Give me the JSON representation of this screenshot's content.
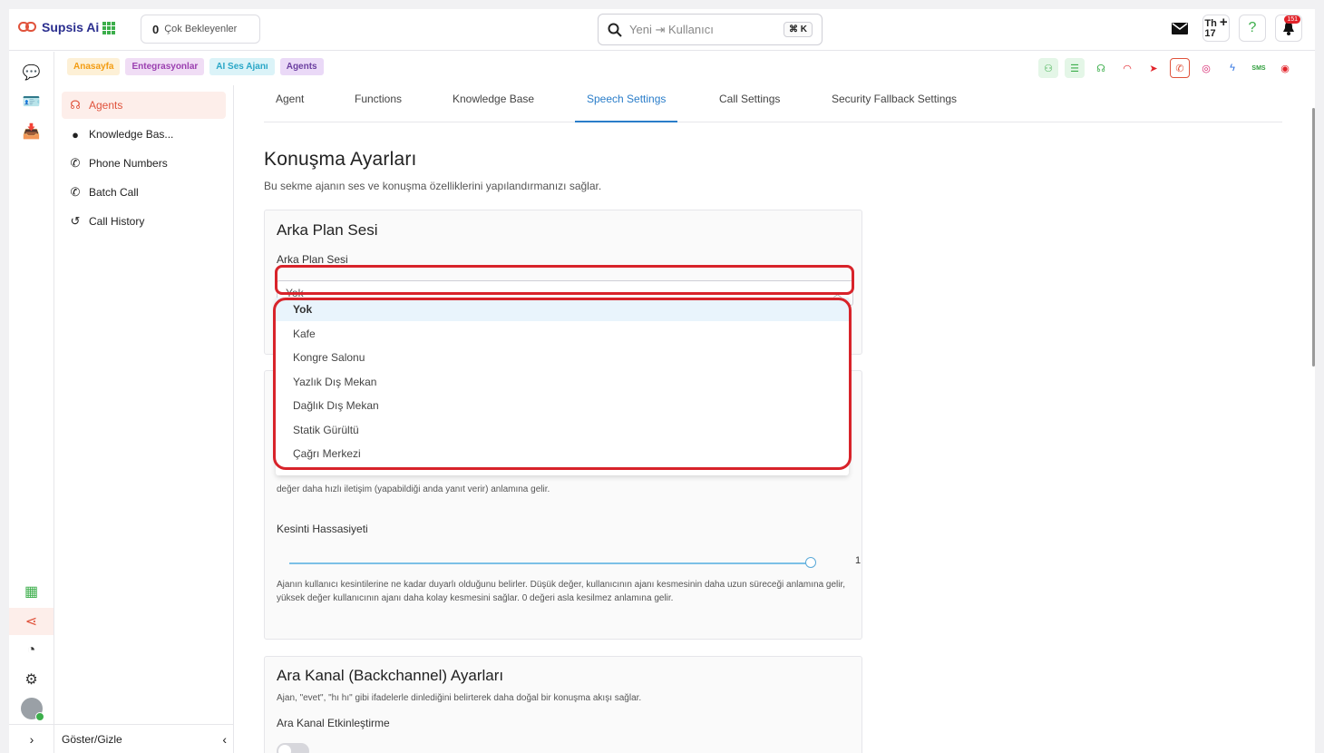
{
  "topbar": {
    "brand": "Supsis Ai",
    "pending_count": "0",
    "pending_label": "Çok Bekleyenler",
    "search_placeholder": "Yeni ⇥ Kullanıcı",
    "search_shortcut": "⌘ K",
    "th_label": "Th",
    "th_date": "17",
    "notification_count": "151"
  },
  "breadcrumbs": [
    {
      "label": "Anasayfa",
      "color": "#f39c12",
      "bg": "#fdf0d6"
    },
    {
      "label": "Entegrasyonlar",
      "color": "#9b3fb0",
      "bg": "#f0ddf5"
    },
    {
      "label": "AI Ses Ajanı",
      "color": "#2aa7c7",
      "bg": "#dbf3f8"
    },
    {
      "label": "Agents",
      "color": "#6b3fa0",
      "bg": "#ead9f7"
    }
  ],
  "sidebar": {
    "items": [
      {
        "label": "Agents",
        "icon": "headset-icon"
      },
      {
        "label": "Knowledge Bas...",
        "icon": "brain-icon"
      },
      {
        "label": "Phone Numbers",
        "icon": "phone-icon"
      },
      {
        "label": "Batch Call",
        "icon": "phone-icon"
      },
      {
        "label": "Call History",
        "icon": "history-icon"
      }
    ],
    "footer_label": "Göster/Gizle"
  },
  "tabs": [
    "Agent",
    "Functions",
    "Knowledge Base",
    "Speech Settings",
    "Call Settings",
    "Security Fallback Settings"
  ],
  "page": {
    "title": "Konuşma Ayarları",
    "subtitle": "Bu sekme ajanın ses ve konuşma özelliklerini yapılandırmanızı sağlar."
  },
  "background_card": {
    "title": "Arka Plan Sesi",
    "field_label": "Arka Plan Sesi",
    "selected": "Yok",
    "options": [
      "Yok",
      "Kafe",
      "Kongre Salonu",
      "Yazlık Dış Mekan",
      "Dağlık Dış Mekan",
      "Statik Gürültü",
      "Çağrı Merkezi"
    ]
  },
  "responsiveness_card": {
    "help_tail": "değer daha hızlı iletişim (yapabildiği anda yanıt verir) anlamına gelir.",
    "interrupt_label": "Kesinti Hassasiyeti",
    "interrupt_value": "1",
    "interrupt_help": "Ajanın kullanıcı kesintilerine ne kadar duyarlı olduğunu belirler. Düşük değer, kullanıcının ajanı kesmesinin daha uzun süreceği anlamına gelir, yüksek değer kullanıcının ajanı daha kolay kesmesini sağlar. 0 değeri asla kesilmez anlamına gelir."
  },
  "backchannel_card": {
    "title": "Ara Kanal (Backchannel) Ayarları",
    "subtitle": "Ajan, \"evet\", \"hı hı\" gibi ifadelerle dinlediğini belirterek daha doğal bir konuşma akışı sağlar.",
    "toggle_label": "Ara Kanal Etkinleştirme",
    "enabled": false
  },
  "colors": {
    "accent": "#e0533c",
    "tab_active": "#2a7dc9",
    "highlight": "#d8232a"
  }
}
